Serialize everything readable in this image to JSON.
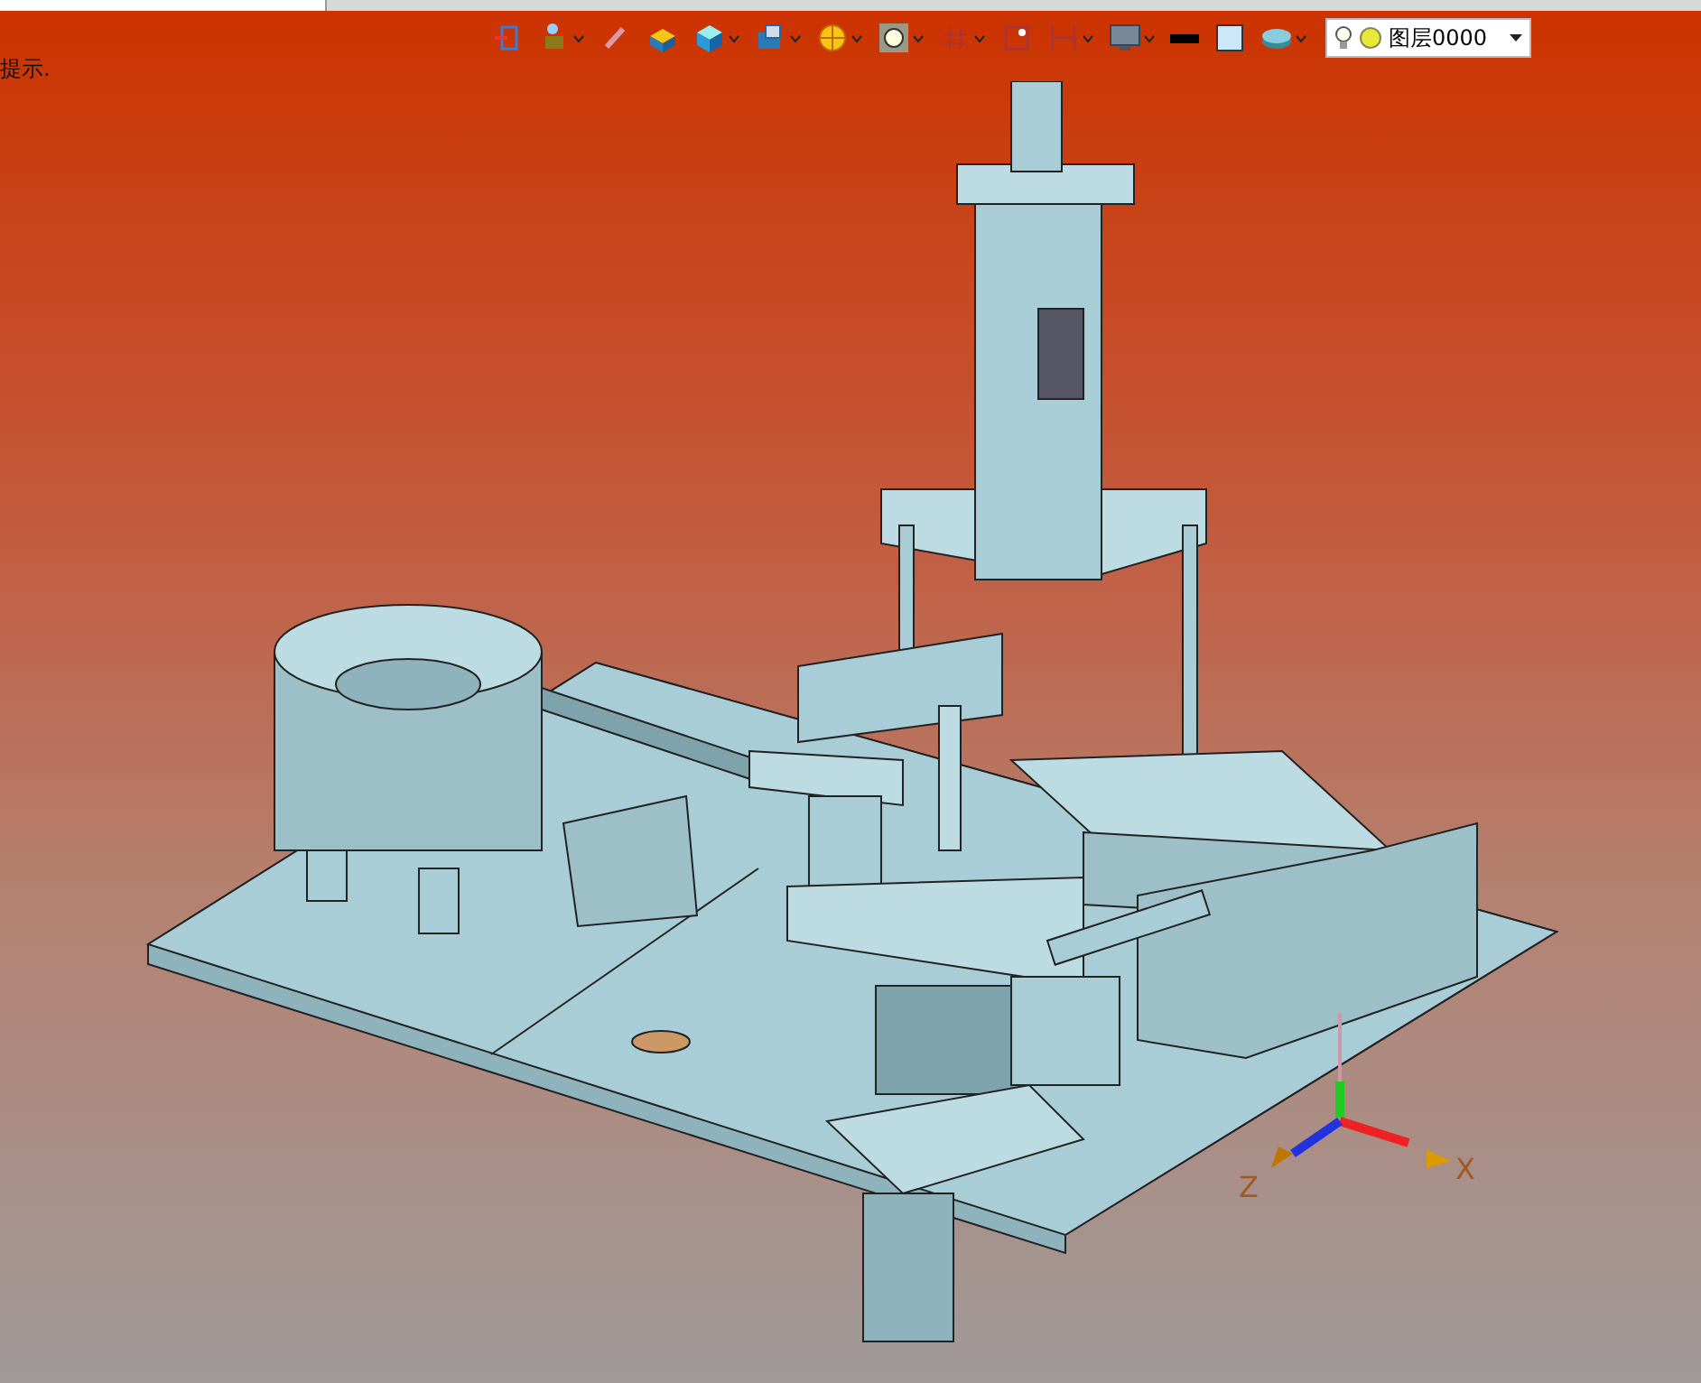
{
  "hint": "提示.",
  "layer_select": {
    "value": "图层0000"
  },
  "axes": [
    {
      "label": "X"
    },
    {
      "label": "Z"
    }
  ]
}
